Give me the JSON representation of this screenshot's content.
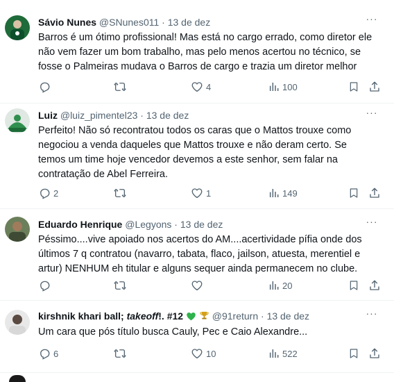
{
  "tweets": [
    {
      "name": "Sávio Nunes",
      "handle": "@SNunes011",
      "sep": "·",
      "date": "13 de dez",
      "text": "Barros é um ótimo profissional! Mas está no cargo errado, como diretor ele\nnão vem fazer um bom trabalho, mas pelo menos acertou no técnico, se\nfosse o Palmeiras mudava o Barros de cargo e trazia um diretor melhor",
      "replies": "",
      "reposts": "",
      "likes": "4",
      "views": "100",
      "more": "···"
    },
    {
      "name": "Luiz",
      "handle": "@luiz_pimentel23",
      "sep": "·",
      "date": "13 de dez",
      "text": "Perfeito!  Não só recontratou todos os caras que o Mattos trouxe como\nnegociou a venda daqueles que Mattos trouxe e não deram certo.  Se\ntemos um time hoje vencedor devemos a este senhor, sem falar na\ncontratação de Abel Ferreira.",
      "replies": "2",
      "reposts": "",
      "likes": "1",
      "views": "149",
      "more": "···"
    },
    {
      "name": "Eduardo Henrique",
      "handle": "@Legyons",
      "sep": "·",
      "date": "13 de dez",
      "text": "Péssimo....vive apoiado nos acertos do AM....acertividade pífia onde dos\núltimos 7 q contratou (navarro, tabata, flaco, jailson, atuesta, merentiel e\nartur) NENHUM eh titular e alguns sequer ainda permanecem no clube.",
      "replies": "",
      "reposts": "",
      "likes": "",
      "views": "20",
      "more": "···"
    },
    {
      "name": "kirshnik khari ball; ",
      "name_italic": "takeoff",
      "name_suffix": "!. #12",
      "handle": "@91return",
      "sep": "·",
      "date": "13 de dez",
      "text": "Um cara que pós título busca Cauly, Pec e Caio Alexandre...",
      "replies": "6",
      "reposts": "",
      "likes": "10",
      "views": "522",
      "more": "···"
    }
  ],
  "colors": {
    "text": "#0f1419",
    "secondary": "#536471",
    "divider": "#eff3f4",
    "heart_green": "#2fb24c",
    "trophy_gold": "#d4a017"
  }
}
